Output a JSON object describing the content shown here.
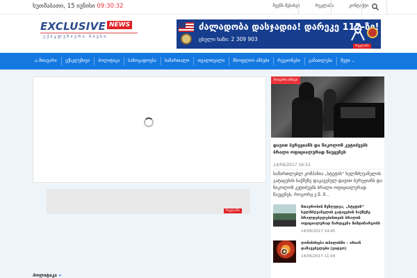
{
  "topbar": {
    "date": "ხუთშაბათი, 15 ივნისი",
    "time": "09:30:32",
    "links": [
      "ჩვენს შესახებ",
      "რეკლამა",
      "კონტაქტი"
    ],
    "search_icon": "search-icon"
  },
  "header": {
    "logo_main": "EXCLUSIVE",
    "logo_badge": "NEWS",
    "logo_sub": "ექსკლუზიური ნიუსი",
    "banner_line1": "ძალადობა დასჯადია! დარეკე 112-ზე!",
    "banner_line2": "ცხელი ხაზი: 2 309 903",
    "ad_label": "რეკლამა"
  },
  "nav": {
    "items": [
      "მთავარი",
      "ექსკლუზივი",
      "პოლიტიკა",
      "საზოგადოება",
      "სამართალი",
      "თვალთვალი",
      "მსოფლიო ამბები",
      "რეგიონები",
      "განათლება",
      "მეტი"
    ],
    "home_icon": "home-icon"
  },
  "main": {
    "ad_label": "რეკლამა",
    "featured": {
      "tag": "მთავარი ამბავი",
      "title": "დავით ბერეჟიანს და ნიკოლოზ კუტიძეებს ბრალი ოფიციალურად წაუყენეს",
      "date": "14/06/2017 16:52",
      "excerpt": "სამართლებლ კომპანია „სტეტის“ ხელმძღვანელის გატაცების საქმეზე დაკავებულ დავით ბერეჟიანს და ნიკოლოზ კუტიძეებს ბრალი ოფიციალურად წაუყენეს, როგორც ე.წ. მ..."
    },
    "items": [
      {
        "title": "მთავრობის შეზღუდვა, „სტეტის“ ხელმძღვანელის გატაცების საქმეზე ბრალდებულებისთვის ბრალის ოფიციალურად წარდგენა მიმდინარეობს",
        "date": "14/06/2017 14:45"
      },
      {
        "title": "ღონისძიება თბილისში – არიან დაშავებულები (ვიდეო)",
        "date": "14/06/2017 11:04"
      }
    ],
    "section_head": "პოლიტიკა",
    "section_arrow": "»"
  }
}
